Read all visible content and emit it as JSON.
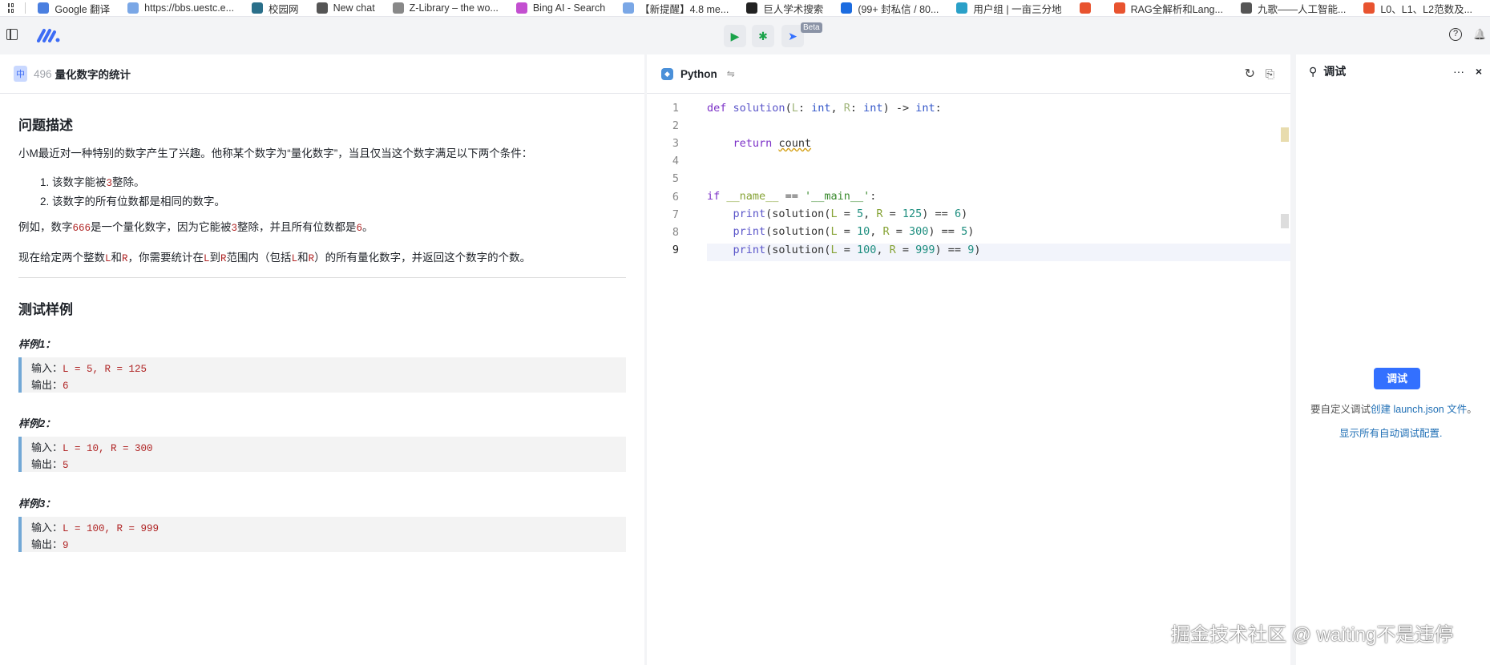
{
  "bookmarks": [
    {
      "label": "Google 翻译",
      "color": "#4a7fe0"
    },
    {
      "label": "https://bbs.uestc.e...",
      "color": "#7aa7e6"
    },
    {
      "label": "校园网",
      "color": "#2a6f8a"
    },
    {
      "label": "New chat",
      "color": "#555555"
    },
    {
      "label": "Z-Library – the wo...",
      "color": "#888888"
    },
    {
      "label": "Bing AI - Search",
      "color": "#c34fd0"
    },
    {
      "label": "【新提醒】4.8 me...",
      "color": "#7aa7e6"
    },
    {
      "label": "巨人学术搜索",
      "color": "#222222"
    },
    {
      "label": "(99+ 封私信 / 80...",
      "color": "#1c6ce0"
    },
    {
      "label": "用户组 | 一亩三分地",
      "color": "#2aa0c8"
    },
    {
      "label": "",
      "color": "#e8532f"
    },
    {
      "label": "RAG全解析和Lang...",
      "color": "#e8532f"
    },
    {
      "label": "九歌——人工智能...",
      "color": "#555555"
    },
    {
      "label": "L0、L1、L2范数及...",
      "color": "#e8532f"
    }
  ],
  "toolbar": {
    "beta": "Beta",
    "run": "▶",
    "debug": "✱",
    "submit": "➤",
    "help": "?",
    "bell": "🔔"
  },
  "problem": {
    "lang_badge": "中",
    "number": "496",
    "title": "量化数字的统计",
    "desc_heading": "问题描述",
    "intro": "小M最近对一种特别的数字产生了兴趣。他称某个数字为“量化数字”，当且仅当这个数字满足以下两个条件：",
    "cond1_a": "1. 该数字能被",
    "cond1_num": "3",
    "cond1_b": "整除。",
    "cond2": "2. 该数字的所有位数都是相同的数字。",
    "ex_a": "例如，数字",
    "ex_num": "666",
    "ex_b": "是一个量化数字，因为它能被",
    "ex_three": "3",
    "ex_c": "整除，并且所有位数都是",
    "ex_six": "6",
    "ex_d": "。",
    "task_a": "现在给定两个整数",
    "L": "L",
    "and": "和",
    "R": "R",
    "task_b": "，你需要统计在",
    "to": "到",
    "task_c": "范围内（包括",
    "task_d": "）的所有量化数字，并返回这个数字的个数。",
    "tests_heading": "测试样例",
    "input_label": "输入：",
    "output_label": "输出：",
    "samples": [
      {
        "label": "样例1：",
        "input": "L = 5, R = 125",
        "output": "6"
      },
      {
        "label": "样例2：",
        "input": "L = 10, R = 300",
        "output": "5"
      },
      {
        "label": "样例3：",
        "input": "L = 100, R = 999",
        "output": "9"
      }
    ]
  },
  "editor": {
    "language": "Python",
    "swap": "⇋",
    "line_numbers": [
      "1",
      "2",
      "3",
      "4",
      "5",
      "6",
      "7",
      "8",
      "9"
    ]
  },
  "debug": {
    "title": "调试",
    "more": "···",
    "close": "×",
    "button": "调试",
    "hint_a": "要自定义调试",
    "hint_link": "创建 launch.json 文件",
    "hint_b": "。",
    "show_all": "显示所有自动调试配置."
  },
  "watermark": "掘金技术社区 @ waiting不是违停"
}
